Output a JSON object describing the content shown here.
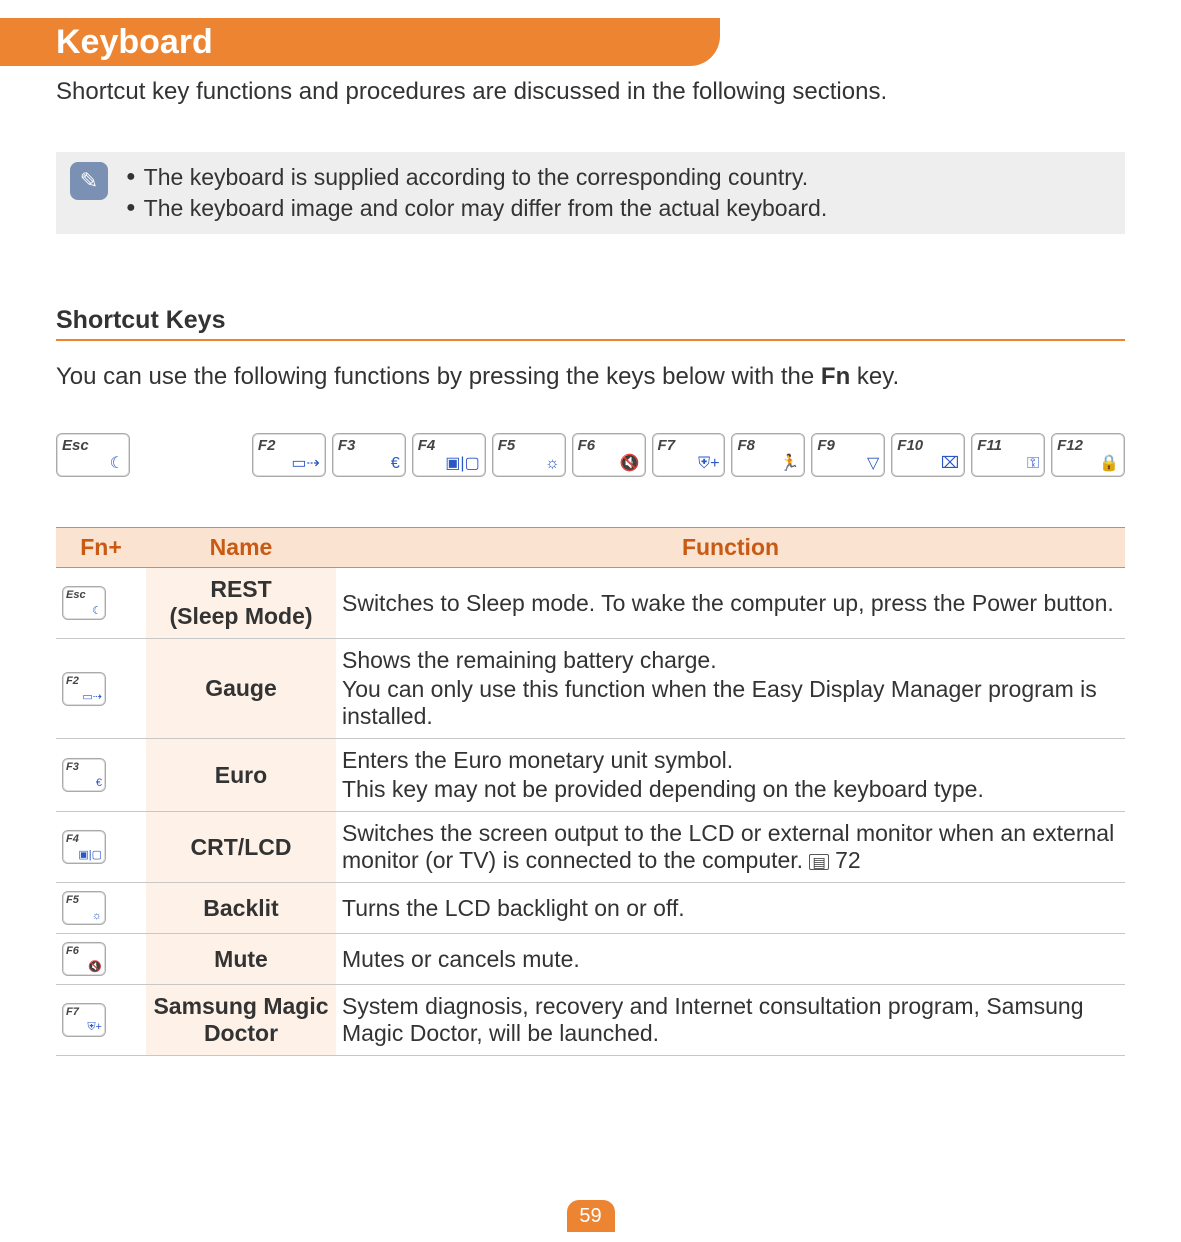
{
  "title": "Keyboard",
  "intro": "Shortcut key functions and procedures are discussed in the following sections.",
  "notes": [
    "The keyboard is supplied according to the corresponding country.",
    "The keyboard image and color may differ from the actual keyboard."
  ],
  "section": {
    "title": "Shortcut Keys",
    "desc_pre": "You can use the following functions by pressing the keys below with the ",
    "fn": "Fn",
    "desc_post": " key."
  },
  "keys": [
    {
      "label": "Esc",
      "icon": "☾"
    },
    {
      "label": "F2",
      "icon": "▭⇢"
    },
    {
      "label": "F3",
      "icon": "€"
    },
    {
      "label": "F4",
      "icon": "▣|▢"
    },
    {
      "label": "F5",
      "icon": "☼"
    },
    {
      "label": "F6",
      "icon": "🔇"
    },
    {
      "label": "F7",
      "icon": "⛨+"
    },
    {
      "label": "F8",
      "icon": "🏃"
    },
    {
      "label": "F9",
      "icon": "▽"
    },
    {
      "label": "F10",
      "icon": "⌧"
    },
    {
      "label": "F11",
      "icon": "⚿"
    },
    {
      "label": "F12",
      "icon": "🔒"
    }
  ],
  "tableHeaders": {
    "col1": "Fn+",
    "col2": "Name",
    "col3": "Function"
  },
  "rows": [
    {
      "key": {
        "label": "Esc",
        "icon": "☾"
      },
      "name": "REST\n(Sleep Mode)",
      "func": [
        "Switches to Sleep mode. To wake the computer up, press the Power button."
      ]
    },
    {
      "key": {
        "label": "F2",
        "icon": "▭⇢"
      },
      "name": "Gauge",
      "func": [
        "Shows the remaining battery charge.",
        "You can only use this function when the Easy Display Manager program is installed."
      ]
    },
    {
      "key": {
        "label": "F3",
        "icon": "€"
      },
      "name": "Euro",
      "func": [
        "Enters the Euro monetary unit symbol.",
        "This key may not be provided depending on the keyboard type."
      ]
    },
    {
      "key": {
        "label": "F4",
        "icon": "▣|▢"
      },
      "name": "CRT/LCD",
      "func": [
        "Switches the screen output to the LCD or external monitor when an external monitor (or TV) is connected to the computer. "
      ],
      "pageRef": "72"
    },
    {
      "key": {
        "label": "F5",
        "icon": "☼"
      },
      "name": "Backlit",
      "func": [
        "Turns the LCD backlight on or off."
      ]
    },
    {
      "key": {
        "label": "F6",
        "icon": "🔇"
      },
      "name": "Mute",
      "func": [
        "Mutes or cancels mute."
      ]
    },
    {
      "key": {
        "label": "F7",
        "icon": "⛨+"
      },
      "name": "Samsung Magic Doctor",
      "func": [
        "System diagnosis, recovery and Internet consultation program, Samsung Magic Doctor, will be launched."
      ]
    }
  ],
  "pageNumber": "59"
}
